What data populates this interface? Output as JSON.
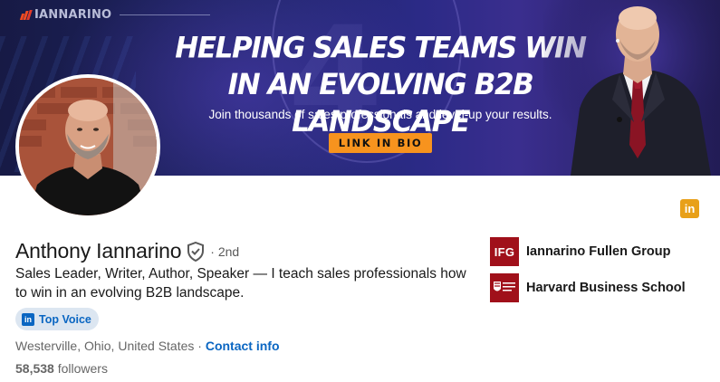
{
  "banner": {
    "logo_text": "IANNARINO",
    "headline_line1": "HELPING SALES TEAMS WIN",
    "headline_line2": "IN AN EVOLVING B2B LANDSCAPE",
    "subline": "Join thousands of sales professionals and level-up your results.",
    "cta_label": "LINK IN BIO",
    "cta_color": "#f7931e"
  },
  "profile": {
    "name": "Anthony Iannarino",
    "verified_icon": "verified-shield-icon",
    "degree": "· 2nd",
    "headline": "Sales Leader, Writer, Author, Speaker — I teach sales professionals how to win in an evolving B2B landscape.",
    "top_voice_label": "Top Voice",
    "location": "Westerville, Ohio, United States",
    "location_sep": "·",
    "contact_label": "Contact info",
    "followers_count": "58,538",
    "followers_label": "followers"
  },
  "linkedin_badge": {
    "text": "in",
    "color": "#e8a019"
  },
  "companies": [
    {
      "logo_text": "IFG",
      "name": "Iannarino Fullen Group"
    },
    {
      "logo_text": "",
      "name": "Harvard Business School"
    }
  ],
  "colors": {
    "link": "#0a66c2",
    "brand_red": "#a0101a",
    "text_secondary": "#666666"
  }
}
